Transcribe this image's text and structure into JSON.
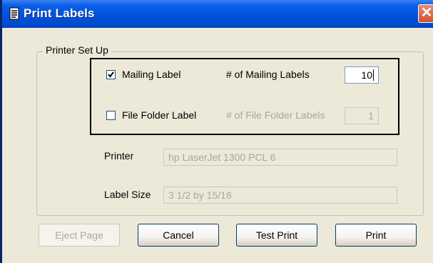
{
  "window": {
    "title": "Print Labels",
    "close_glyph": "✕"
  },
  "group": {
    "legend": "Printer Set Up"
  },
  "mailing": {
    "checked": true,
    "label": "Mailing Label",
    "count_label": "# of Mailing Labels",
    "count_value": "10"
  },
  "folder": {
    "checked": false,
    "label": "File Folder Label",
    "count_label": "# of File Folder Labels",
    "count_value": "1"
  },
  "printer": {
    "label": "Printer",
    "value": "hp LaserJet 1300 PCL 6"
  },
  "label_size": {
    "label": "Label Size",
    "value": "3 1/2 by 15/16"
  },
  "buttons": {
    "eject": "Eject Page",
    "cancel": "Cancel",
    "test_print": "Test Print",
    "print": "Print"
  },
  "colors": {
    "title_bar": "#0052dd",
    "dialog_bg": "#ece9d8",
    "disabled_text": "#aca899"
  }
}
